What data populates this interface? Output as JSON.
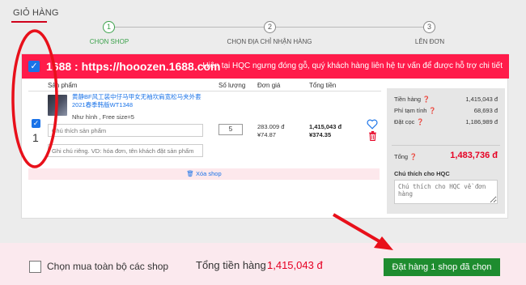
{
  "header": {
    "title": "GIỎ HÀNG"
  },
  "stepper": {
    "steps": [
      {
        "num": "1",
        "label": "CHỌN SHOP"
      },
      {
        "num": "2",
        "label": "CHỌN ĐỊA CHỈ NHẬN HÀNG"
      },
      {
        "num": "3",
        "label": "LÊN ĐƠN"
      }
    ]
  },
  "shop": {
    "name": "1688 : https://hooozen.1688.com",
    "notice": "Hiện tại HQC ngưng đóng gỗ, quý khách hàng liên hệ tư vấn để được hỗ trợ chi tiết"
  },
  "table": {
    "headers": [
      "Sản phẩm",
      "Số lượng",
      "Đơn giá",
      "Tổng tiền"
    ]
  },
  "item": {
    "index": "1",
    "title": "黄静BF风工装中仔马甲女无袖坎肩宽松马夹外套2021春季韩版WT1348",
    "variant": "Như hình , Free size=5",
    "note_placeholder": "Chú thích sản phẩm",
    "private_placeholder": "Ghi chú riêng. VD: hóa đơn, tên khách đặt sản phẩm",
    "quantity": "5",
    "unit_price": "283.009 đ",
    "unit_price_cny": "¥74.87",
    "total": "1,415,043 đ",
    "total_cny": "¥374.35"
  },
  "delete_shop_label": "🗑 Xóa shop",
  "summary": {
    "rows": [
      {
        "label": "Tiền hàng ❓",
        "value": "1,415,043 đ"
      },
      {
        "label": "Phí tạm tính ❓",
        "value": "68,693 đ"
      },
      {
        "label": "Đặt cọc ❓",
        "value": "1,186,989 đ"
      }
    ],
    "total_label": "Tổng ❓",
    "total_value": "1,483,736 đ",
    "note_label": "Chú thích cho HQC",
    "note_placeholder": "Chú thích cho HQC về đơn hàng"
  },
  "bottom": {
    "select_all_label": "Chọn mua toàn bộ các shop",
    "grand_total_label": "Tổng tiền hàng :",
    "grand_total_value": "1,415,043 đ",
    "order_button": "Đặt hàng 1 shop đã chọn"
  },
  "colors": {
    "shop_bar": "#ff1b4a",
    "accent_green": "#1e8c2f",
    "price_red": "#e60023",
    "link_blue": "#1a73e8",
    "annotation_red": "#e8101a"
  }
}
